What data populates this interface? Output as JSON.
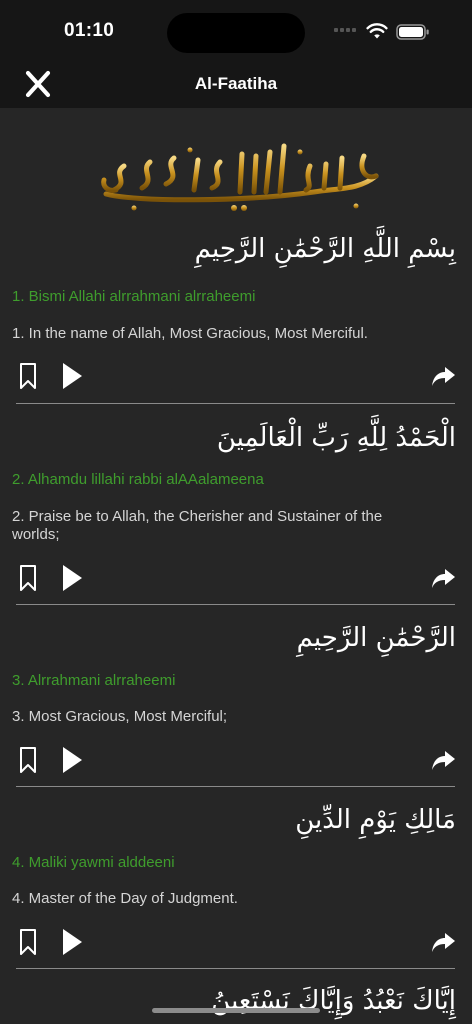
{
  "status_bar": {
    "time": "01:10"
  },
  "nav": {
    "title": "Al-Faatiha",
    "close_icon": "close-icon"
  },
  "header": {
    "bismillah_image": "bismillah-calligraphy"
  },
  "verses": [
    {
      "arabic": "بِسْمِ اللَّهِ الرَّحْمَٰنِ الرَّحِيمِ",
      "transliteration": "1. Bismi Allahi alrrahmani alrraheemi",
      "translation": "1. In the name of Allah, Most Gracious, Most Merciful."
    },
    {
      "arabic": "الْحَمْدُ لِلَّهِ رَبِّ الْعَالَمِينَ",
      "transliteration": "2. Alhamdu lillahi rabbi alAAalameena",
      "translation": "2. Praise be to Allah, the Cherisher and Sustainer of the worlds;"
    },
    {
      "arabic": "الرَّحْمَٰنِ الرَّحِيمِ",
      "transliteration": "3. Alrrahmani alrraheemi",
      "translation": "3. Most Gracious, Most Merciful;"
    },
    {
      "arabic": "مَالِكِ يَوْمِ الدِّينِ",
      "transliteration": "4. Maliki yawmi alddeeni",
      "translation": "4. Master of the Day of Judgment."
    },
    {
      "arabic": "إِيَّاكَ نَعْبُدُ وَإِيَّاكَ نَسْتَعِينُ"
    }
  ],
  "icons": {
    "bookmark": "bookmark-icon",
    "play": "play-icon",
    "share": "share-icon"
  },
  "colors": {
    "transliteration": "#3f9d2d",
    "background": "#262626",
    "bar": "#161616",
    "gold": "#d6a53a"
  }
}
